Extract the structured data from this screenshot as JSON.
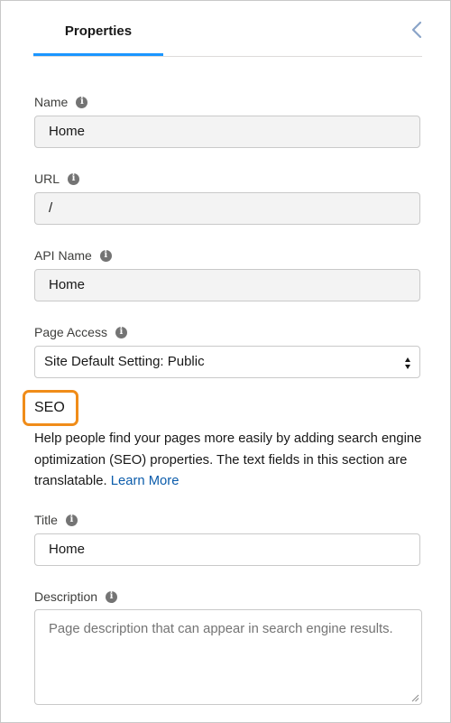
{
  "tabs": {
    "properties_label": "Properties"
  },
  "icons": {
    "collapse": "chevron-left-icon",
    "info": "info-icon",
    "select_arrows": "up-down-arrows-icon",
    "resize": "resize-handle-icon"
  },
  "colors": {
    "accent": "#1b96ff",
    "highlight": "#f08c19",
    "link": "#0b5cab",
    "readonly_bg": "#f3f3f3"
  },
  "form": {
    "name": {
      "label": "Name",
      "value": "Home"
    },
    "url": {
      "label": "URL",
      "value": "/"
    },
    "api_name": {
      "label": "API Name",
      "value": "Home"
    },
    "page_access": {
      "label": "Page Access",
      "value": "Site Default Setting: Public"
    },
    "seo": {
      "heading": "SEO",
      "help_text": "Help people find your pages more easily by adding search engine optimization (SEO) properties. The text fields in this section are translatable.",
      "learn_more": "Learn More"
    },
    "title": {
      "label": "Title",
      "value": "Home"
    },
    "description": {
      "label": "Description",
      "placeholder": "Page description that can appear in search engine results."
    }
  }
}
